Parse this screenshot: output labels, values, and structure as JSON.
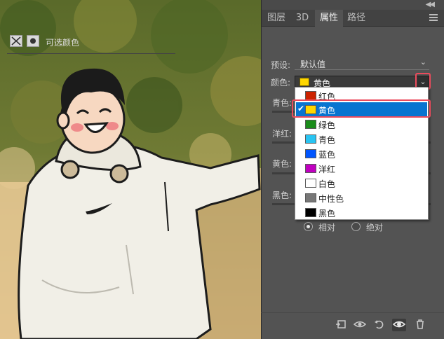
{
  "panel": {
    "tabs": [
      "图层",
      "3D",
      "属性",
      "路径"
    ],
    "active_tab": "属性",
    "title": "可选颜色"
  },
  "preset": {
    "label": "预设:",
    "value": "默认值"
  },
  "colors_field": {
    "label": "颜色:",
    "value": "黄色"
  },
  "color_options": [
    {
      "name": "红色",
      "color": "#cc2200"
    },
    {
      "name": "黄色",
      "color": "#ffd700",
      "selected": true
    },
    {
      "name": "绿色",
      "color": "#1a8c1a"
    },
    {
      "name": "青色",
      "color": "#29c4f2"
    },
    {
      "name": "蓝色",
      "color": "#0055ff"
    },
    {
      "name": "洋红",
      "color": "#c000c0"
    },
    {
      "name": "白色",
      "color": "#ffffff"
    },
    {
      "name": "中性色",
      "color": "#777777"
    },
    {
      "name": "黑色",
      "color": "#000000"
    }
  ],
  "adjust_labels": {
    "cyan": "青色:",
    "magenta": "洋红:",
    "yellow": "黄色:",
    "black": "黑色:"
  },
  "method": {
    "relative": "相对",
    "absolute": "绝对",
    "selected": "相对"
  },
  "highlight_color": "#ec4b5c",
  "selection_color": "#0874d0",
  "icons": {
    "panel_collapse": "double-chevron-icon",
    "panel_menu": "hamburger-menu-icon",
    "bottom_tools": [
      "clip-to-layer-icon",
      "view-previous-icon",
      "reset-icon",
      "visibility-eye-icon",
      "trash-icon"
    ]
  }
}
